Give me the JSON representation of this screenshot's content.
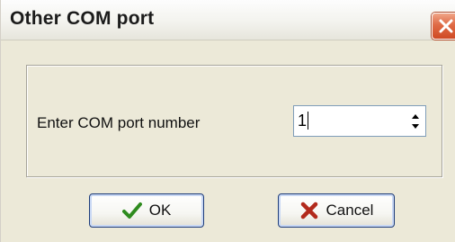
{
  "window": {
    "title": "Other COM port"
  },
  "form": {
    "port_label": "Enter COM port number",
    "port_value": "1"
  },
  "buttons": {
    "ok_label": "OK",
    "cancel_label": "Cancel"
  },
  "icons": {
    "close": "close-icon",
    "ok": "checkmark-icon",
    "cancel": "x-mark-icon",
    "spin_up": "triangle-up-icon",
    "spin_down": "triangle-down-icon"
  },
  "colors": {
    "close_button": "#d9552f",
    "checkmark": "#2e8b1e",
    "cancel_x": "#b22a1c",
    "dialog_background": "#ece9d8"
  }
}
